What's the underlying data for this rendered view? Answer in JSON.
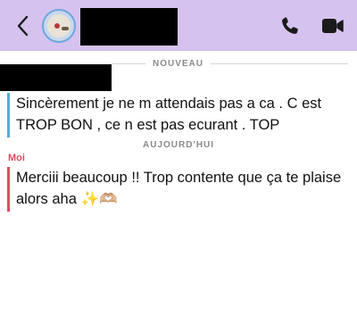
{
  "header": {
    "back_icon": "chevron-left-icon",
    "call_icon": "phone-icon",
    "video_icon": "video-camera-icon",
    "bg_color": "#d6c2ee"
  },
  "separators": {
    "new": "NOUVEAU",
    "today": "AUJOURD'HUI"
  },
  "messages": [
    {
      "sender": "",
      "text": "Sincèrement je ne  m attendais pas a ca . C est TROP BON , ce n est pas ecurant . TOP",
      "bar_color": "#58aadf"
    },
    {
      "sender": "Moi",
      "text": "Merciii beaucoup !! Trop contente que ça te plaise alors aha ✨🫶🏼",
      "bar_color": "#e0495f"
    }
  ]
}
